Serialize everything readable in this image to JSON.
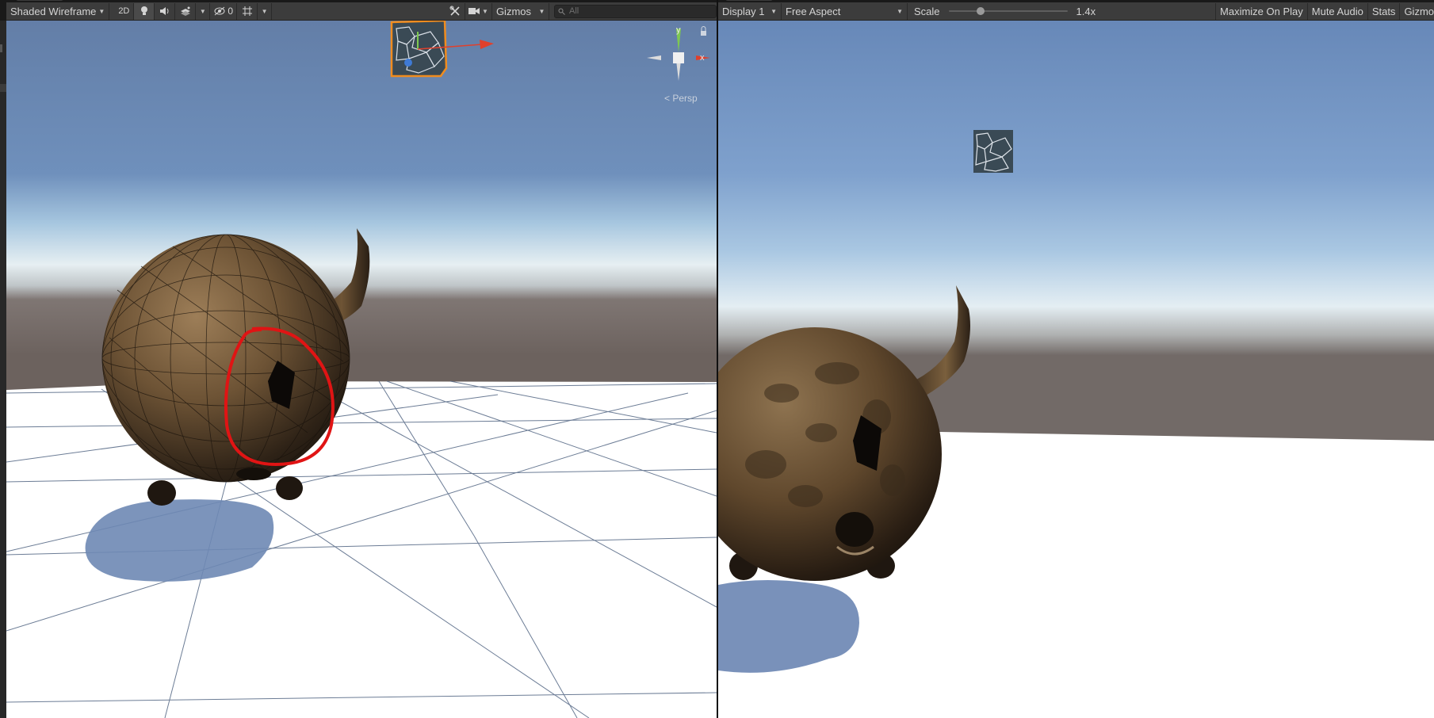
{
  "scene_toolbar": {
    "draw_mode": "Shaded Wireframe",
    "mode_2d": "2D",
    "hidden_count": "0",
    "gizmos_label": "Gizmos",
    "search_placeholder": "All"
  },
  "game_toolbar": {
    "display": "Display 1",
    "aspect": "Free Aspect",
    "scale_label": "Scale",
    "scale_value": "1.4x",
    "scale_fraction": 0.25,
    "maximize_on_play": "Maximize On Play",
    "mute_audio": "Mute Audio",
    "stats": "Stats",
    "gizmos_truncated": "Gizmo"
  },
  "scene_view": {
    "orientation_gizmo": {
      "y_label": "y",
      "x_label": "x"
    },
    "projection_label": "Persp"
  },
  "colors": {
    "toolbar_bg": "#3c3c3c",
    "selection_outline": "#f08c1e",
    "annotation_circle": "#e01414",
    "gizmo_y": "#7ec850",
    "gizmo_x": "#e0402c",
    "sky_top": "#6c8bb4",
    "horizon": "#e6eef2",
    "ground_band": "#6e6460",
    "floor": "#ffffff",
    "shadow": "#6e88b4"
  },
  "icons": [
    "lightbulb-icon",
    "speaker-icon",
    "effects-icon",
    "hidden-icon",
    "grid-icon",
    "tools-icon",
    "camera-icon",
    "search-icon",
    "lock-icon",
    "dropdown-arrow-icon"
  ]
}
